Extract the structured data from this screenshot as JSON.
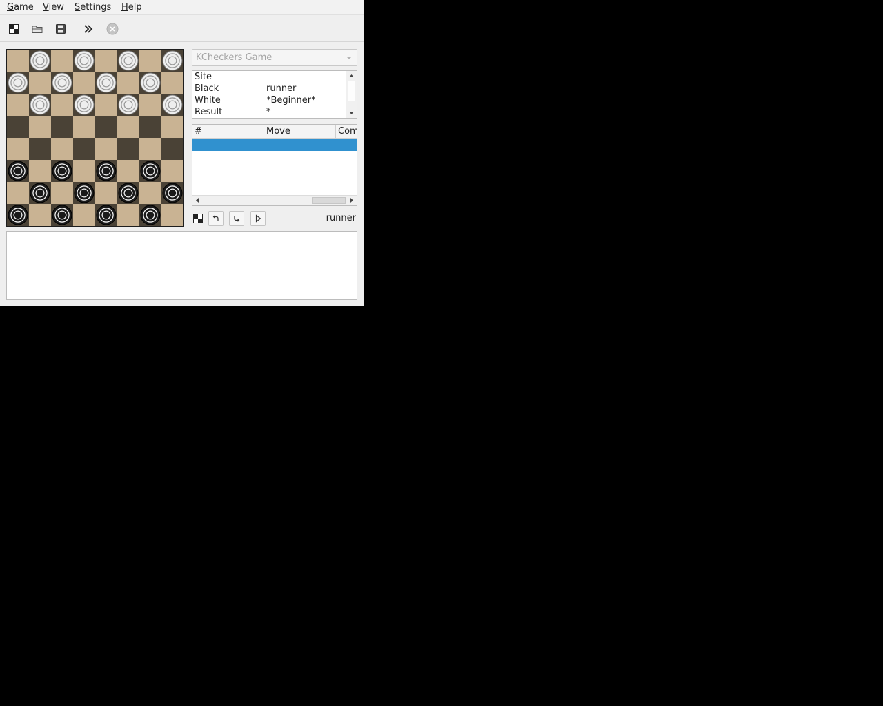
{
  "menubar": {
    "items": [
      {
        "mnemonic": "G",
        "rest": "ame"
      },
      {
        "mnemonic": "V",
        "rest": "iew"
      },
      {
        "mnemonic": "S",
        "rest": "ettings"
      },
      {
        "mnemonic": "H",
        "rest": "elp"
      }
    ]
  },
  "toolbar": {
    "icons": [
      "new-game-icon",
      "open-folder-icon",
      "save-icon",
      "fast-forward-icon",
      "stop-icon"
    ]
  },
  "board": {
    "size": 8,
    "description_rows": [
      ".w.w.w.w",
      "w.w.w.w.",
      ".w.w.w.w",
      "........",
      "........",
      "b.b.b.b.",
      ".b.b.b.b",
      "b.b.b.b."
    ],
    "colors": {
      "light_square": "#c9b393",
      "dark_square": "#4a4236",
      "white_piece": "#eeeeee",
      "black_piece": "#1a1a1a"
    }
  },
  "game_combo": {
    "value": "KCheckers Game"
  },
  "info": {
    "rows": [
      {
        "key": "Site",
        "value": ""
      },
      {
        "key": "Black",
        "value": "runner"
      },
      {
        "key": "White",
        "value": "*Beginner*"
      },
      {
        "key": "Result",
        "value": "*"
      }
    ]
  },
  "moves": {
    "columns": [
      "#",
      "Move",
      "Com"
    ],
    "selected_color": "#3091cf"
  },
  "nav": {
    "player": "runner"
  },
  "log": {
    "text": ""
  }
}
